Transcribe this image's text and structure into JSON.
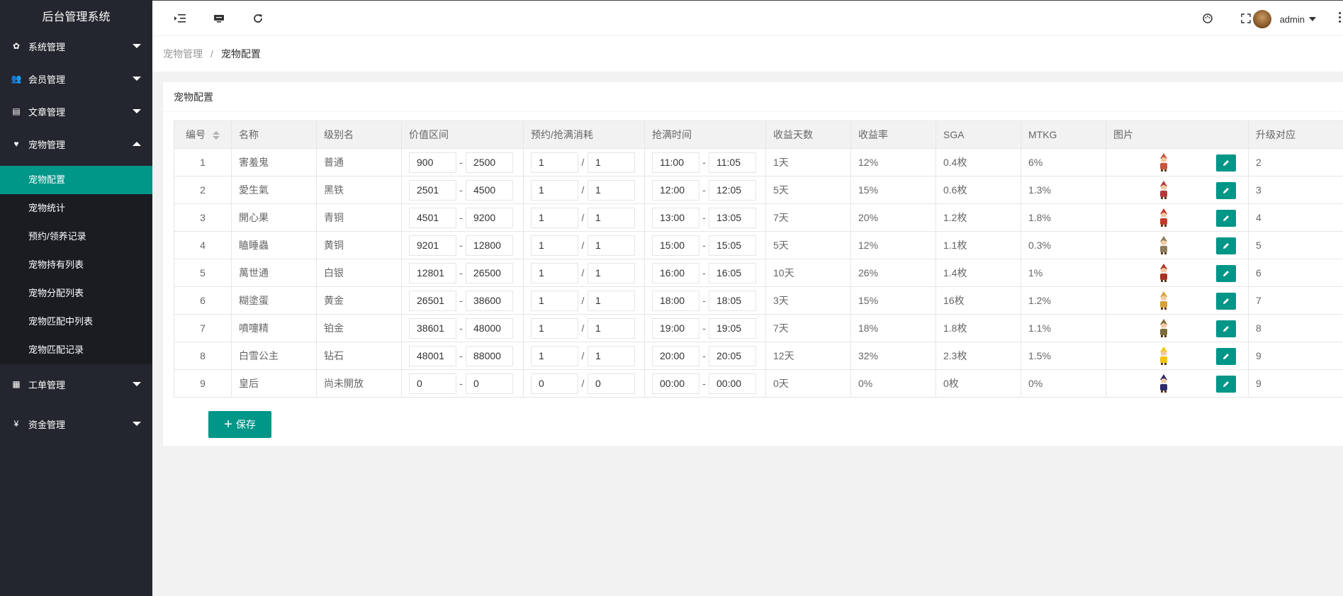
{
  "app_title": "后台管理系统",
  "nav": {
    "system": "系统管理",
    "member": "会员管理",
    "article": "文章管理",
    "pet": "宠物管理",
    "pet_sub": [
      "宠物配置",
      "宠物统计",
      "预约/领养记录",
      "宠物持有列表",
      "宠物分配列表",
      "宠物匹配中列表",
      "宠物匹配记录"
    ],
    "ticket": "工单管理",
    "funds": "资金管理",
    "funds_icon": "¥"
  },
  "topbar": {
    "username": "admin"
  },
  "breadcrumb": {
    "parent": "宠物管理",
    "sep": "/",
    "current": "宠物配置"
  },
  "card_title": "宠物配置",
  "table": {
    "headers": [
      "编号",
      "名称",
      "级别名",
      "价值区间",
      "预约/抢满消耗",
      "抢满时间",
      "收益天数",
      "收益率",
      "SGA",
      "MTKG",
      "图片",
      "升级对应"
    ],
    "rows": [
      {
        "id": "1",
        "name": "害羞鬼",
        "level": "普通",
        "vmin": "900",
        "vmax": "2500",
        "c1": "1",
        "c2": "1",
        "t1": "11:00",
        "t2": "11:05",
        "days": "1天",
        "rate": "12%",
        "sga": "0.4枚",
        "mtkg": "6%",
        "up": "2",
        "color": "#c8553d"
      },
      {
        "id": "2",
        "name": "愛生氣",
        "level": "黑铁",
        "vmin": "2501",
        "vmax": "4500",
        "c1": "1",
        "c2": "1",
        "t1": "12:00",
        "t2": "12:05",
        "days": "5天",
        "rate": "15%",
        "sga": "0.6枚",
        "mtkg": "1.3%",
        "up": "3",
        "color": "#b23a3a"
      },
      {
        "id": "3",
        "name": "開心果",
        "level": "青铜",
        "vmin": "4501",
        "vmax": "9200",
        "c1": "1",
        "c2": "1",
        "t1": "13:00",
        "t2": "13:05",
        "days": "7天",
        "rate": "20%",
        "sga": "1.2枚",
        "mtkg": "1.8%",
        "up": "4",
        "color": "#c0392b"
      },
      {
        "id": "4",
        "name": "瞌睡蟲",
        "level": "黄铜",
        "vmin": "9201",
        "vmax": "12800",
        "c1": "1",
        "c2": "1",
        "t1": "15:00",
        "t2": "15:05",
        "days": "5天",
        "rate": "12%",
        "sga": "1.1枚",
        "mtkg": "0.3%",
        "up": "5",
        "color": "#8e7b5a"
      },
      {
        "id": "5",
        "name": "萬世通",
        "level": "白银",
        "vmin": "12801",
        "vmax": "26500",
        "c1": "1",
        "c2": "1",
        "t1": "16:00",
        "t2": "16:05",
        "days": "10天",
        "rate": "26%",
        "sga": "1.4枚",
        "mtkg": "1%",
        "up": "6",
        "color": "#a93226"
      },
      {
        "id": "6",
        "name": "糊塗蛋",
        "level": "黄金",
        "vmin": "26501",
        "vmax": "38600",
        "c1": "1",
        "c2": "1",
        "t1": "18:00",
        "t2": "18:05",
        "days": "3天",
        "rate": "15%",
        "sga": "16枚",
        "mtkg": "1.2%",
        "up": "7",
        "color": "#d4a23a"
      },
      {
        "id": "7",
        "name": "噴嚏精",
        "level": "铂金",
        "vmin": "38601",
        "vmax": "48000",
        "c1": "1",
        "c2": "1",
        "t1": "19:00",
        "t2": "19:05",
        "days": "7天",
        "rate": "18%",
        "sga": "1.8枚",
        "mtkg": "1.1%",
        "up": "8",
        "color": "#7d6b3a"
      },
      {
        "id": "8",
        "name": "白雪公主",
        "level": "钻石",
        "vmin": "48001",
        "vmax": "88000",
        "c1": "1",
        "c2": "1",
        "t1": "20:00",
        "t2": "20:05",
        "days": "12天",
        "rate": "32%",
        "sga": "2.3枚",
        "mtkg": "1.5%",
        "up": "9",
        "color": "#f1c40f"
      },
      {
        "id": "9",
        "name": "皇后",
        "level": "尚未開放",
        "vmin": "0",
        "vmax": "0",
        "c1": "0",
        "c2": "0",
        "t1": "00:00",
        "t2": "00:00",
        "days": "0天",
        "rate": "0%",
        "sga": "0枚",
        "mtkg": "0%",
        "up": "9",
        "color": "#2c2c6c"
      }
    ]
  },
  "save_label": "保存",
  "colors": {
    "accent": "#009688",
    "sidebar": "#23262e"
  }
}
